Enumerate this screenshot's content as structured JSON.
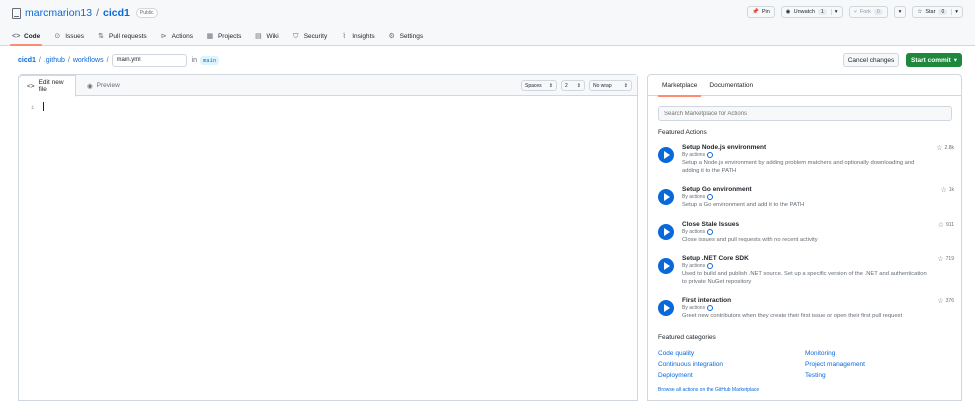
{
  "header": {
    "owner": "marcmarion13",
    "separator": "/",
    "repo": "cicd1",
    "visibility": "Public",
    "pin_label": "Pin",
    "unwatch_label": "Unwatch",
    "unwatch_count": "1",
    "fork_label": "Fork",
    "fork_count": "0",
    "star_label": "Star",
    "star_count": "0"
  },
  "nav": {
    "code": "Code",
    "issues": "Issues",
    "pull_requests": "Pull requests",
    "actions": "Actions",
    "projects": "Projects",
    "wiki": "Wiki",
    "security": "Security",
    "insights": "Insights",
    "settings": "Settings"
  },
  "path": {
    "repo": "cicd1",
    "dir1": ".github",
    "dir2": "workflows",
    "sep": "/",
    "filename": "main.yml",
    "in": "in",
    "branch": "main"
  },
  "buttons": {
    "cancel": "Cancel changes",
    "commit": "Start commit",
    "caret": "▾"
  },
  "editor": {
    "tab_edit": "Edit new file",
    "tab_preview": "Preview",
    "indent_mode": "Spaces",
    "indent_size": "2",
    "wrap_mode": "No wrap",
    "line_number": "1"
  },
  "side": {
    "tab_marketplace": "Marketplace",
    "tab_documentation": "Documentation",
    "search_placeholder": "Search Marketplace for Actions",
    "featured_actions": "Featured Actions",
    "actions": [
      {
        "title": "Setup Node.js environment",
        "by": "By actions",
        "desc": "Setup a Node.js environment by adding problem matchers and optionally downloading and adding it to the PATH",
        "stars": "2.8k"
      },
      {
        "title": "Setup Go environment",
        "by": "By actions",
        "desc": "Setup a Go environment and add it to the PATH",
        "stars": "1k"
      },
      {
        "title": "Close Stale Issues",
        "by": "By actions",
        "desc": "Close issues and pull requests with no recent activity",
        "stars": "911"
      },
      {
        "title": "Setup .NET Core SDK",
        "by": "By actions",
        "desc": "Used to build and publish .NET source. Set up a specific version of the .NET and authentication to private NuGet repository",
        "stars": "719"
      },
      {
        "title": "First interaction",
        "by": "By actions",
        "desc": "Greet new contributors when they create their first issue or open their first pull request",
        "stars": "376"
      }
    ],
    "featured_categories": "Featured categories",
    "categories": [
      "Code quality",
      "Continuous integration",
      "Deployment",
      "Monitoring",
      "Project management",
      "Testing"
    ],
    "browse": "Browse all actions on the GitHub Marketplace"
  }
}
